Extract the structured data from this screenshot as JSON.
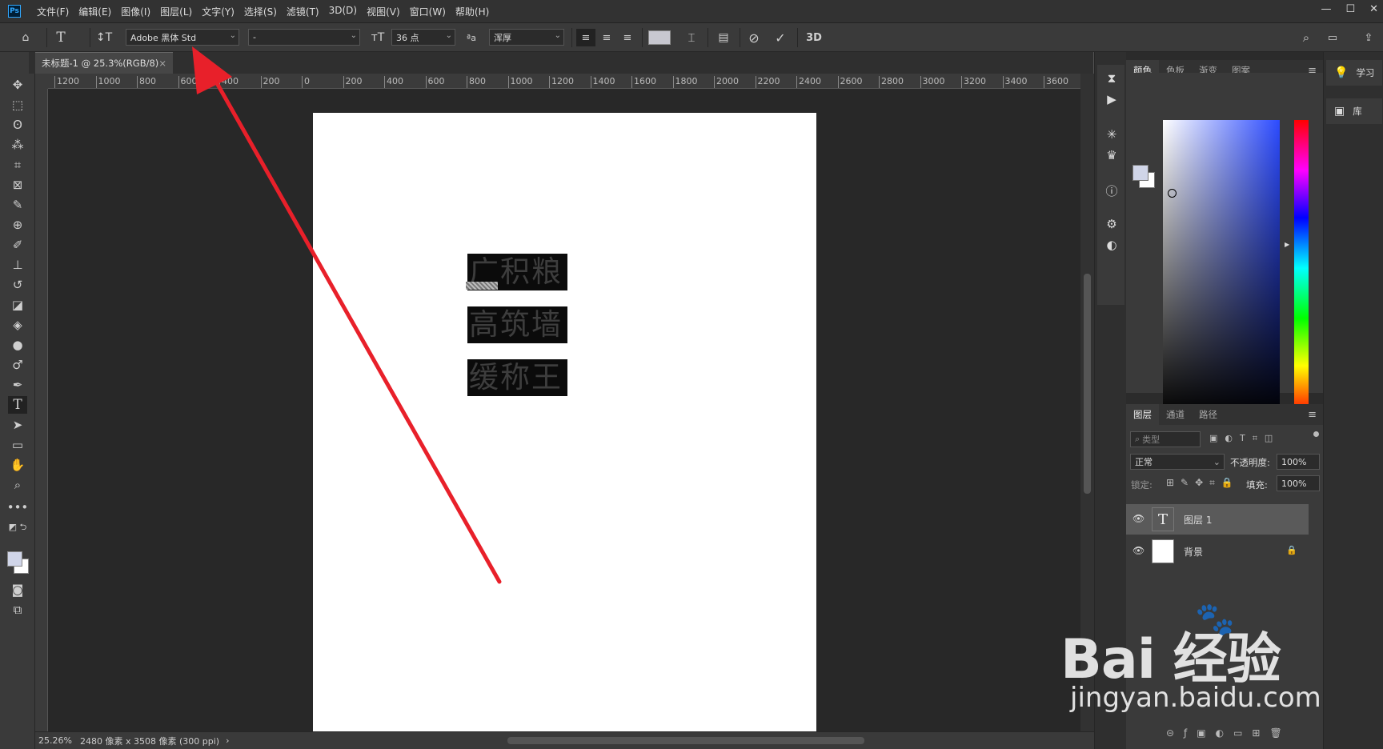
{
  "app": {
    "logo": "Ps",
    "menu": [
      "文件(F)",
      "编辑(E)",
      "图像(I)",
      "图层(L)",
      "文字(Y)",
      "选择(S)",
      "滤镜(T)",
      "3D(D)",
      "视图(V)",
      "窗口(W)",
      "帮助(H)"
    ],
    "window_controls": [
      "—",
      "☐",
      "✕"
    ]
  },
  "options": {
    "font_family": "Adobe 黑体 Std",
    "font_style": "-",
    "font_size": "36 点",
    "aa_label": "ªa",
    "antialias": "浑厚",
    "threed": "3D"
  },
  "document": {
    "tab_title": "未标题-1 @ 25.3%(RGB/8)",
    "close": "×",
    "lines": [
      "广积粮",
      "高筑墙",
      "缓称王"
    ]
  },
  "ruler": {
    "ticks": [
      "1200",
      "1000",
      "800",
      "600",
      "400",
      "200",
      "0",
      "200",
      "400",
      "600",
      "800",
      "1000",
      "1200",
      "1400",
      "1600",
      "1800",
      "2000",
      "2200",
      "2400",
      "2600",
      "2800",
      "3000",
      "3200",
      "3400",
      "3600"
    ]
  },
  "status": {
    "zoom": "25.26%",
    "info": "2480 像素 x 3508 像素 (300 ppi)",
    "arrow": "›"
  },
  "color_panel": {
    "tabs": [
      "颜色",
      "色板",
      "渐变",
      "图案"
    ],
    "fg_color": "#d0d5e8",
    "bg_color": "#ffffff"
  },
  "layers_panel": {
    "tabs": [
      "图层",
      "通道",
      "路径"
    ],
    "search_placeholder": "类型",
    "blend_mode": "正常",
    "opacity_label": "不透明度:",
    "opacity": "100%",
    "lock_label": "锁定:",
    "fill_label": "填充:",
    "fill": "100%",
    "layers": [
      {
        "name": "图层 1",
        "type": "text",
        "selected": true
      },
      {
        "name": "背景",
        "type": "image",
        "selected": false
      }
    ]
  },
  "far_right": {
    "items": [
      {
        "label": "学习",
        "icon": "lightbulb-icon"
      },
      {
        "label": "库",
        "icon": "library-icon"
      }
    ]
  },
  "watermark": {
    "main": "Bai 经验",
    "sub": "jingyan.baidu.com"
  },
  "annotation": {
    "arrow_color": "#e8202a"
  }
}
